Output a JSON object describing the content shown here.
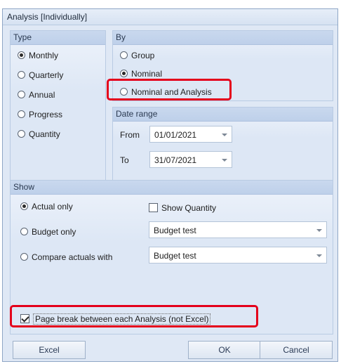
{
  "dialog": {
    "title": "Analysis [Individually]"
  },
  "type_group": {
    "heading": "Type",
    "options": [
      {
        "label": "Monthly",
        "selected": true
      },
      {
        "label": "Quarterly",
        "selected": false
      },
      {
        "label": "Annual",
        "selected": false
      },
      {
        "label": "Progress",
        "selected": false
      },
      {
        "label": "Quantity",
        "selected": false
      }
    ]
  },
  "by_group": {
    "heading": "By",
    "options": [
      {
        "label": "Group",
        "selected": false
      },
      {
        "label": "Nominal",
        "selected": true
      },
      {
        "label": "Nominal and Analysis",
        "selected": false
      }
    ]
  },
  "date_range": {
    "heading": "Date range",
    "from_label": "From",
    "from_value": "01/01/2021",
    "to_label": "To",
    "to_value": "31/07/2021"
  },
  "show_group": {
    "heading": "Show",
    "options": [
      {
        "label": "Actual only",
        "selected": true
      },
      {
        "label": "Budget only",
        "selected": false
      },
      {
        "label": "Compare actuals with",
        "selected": false
      }
    ],
    "show_quantity_label": "Show Quantity",
    "show_quantity_checked": false,
    "budget_only_value": "Budget test",
    "compare_value": "Budget test",
    "page_break_label": "Page break between each Analysis (not Excel)",
    "page_break_checked": true
  },
  "buttons": {
    "excel": "Excel",
    "ok": "OK",
    "cancel": "Cancel"
  },
  "colors": {
    "highlight": "#e4001b",
    "accent": "#bed0ea"
  }
}
